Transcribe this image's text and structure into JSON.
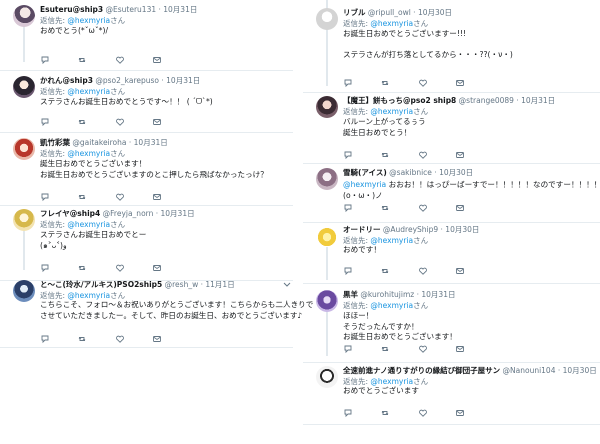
{
  "reply_prefix": "返信先: ",
  "reply_suffix": "さん",
  "colors": {
    "accent": "#1b95e0",
    "muted": "#657786",
    "thread": "#e1e8ed"
  },
  "left": [
    {
      "name": "Esuteru@ship3",
      "handle": "@Esuteru131",
      "date": "10月31日",
      "reply_to": "@hexmyria",
      "lines": [
        "おめでとう(*ˇωˇ*)/"
      ],
      "avatar": "avatar-esuteru"
    },
    {
      "name": "かれん@ship3",
      "handle": "@pso2_karepuso",
      "date": "10月31日",
      "reply_to": "@hexmyria",
      "lines": [
        "ステラさんお誕生日おめでとうです～！！ ( ´ᗜ`*)"
      ],
      "avatar": "avatar-karen"
    },
    {
      "name": "凱竹彩葉",
      "handle": "@gaitakeiroha",
      "date": "10月31日",
      "reply_to": "@hexmyria",
      "lines": [
        "誕生日おめでとうございます！",
        "お誕生日おめでとうございますのとこ押したら飛ばなかったっけ？"
      ],
      "avatar": "avatar-iroha"
    },
    {
      "name": "フレイヤ@ship4",
      "handle": "@Freyja_norn",
      "date": "10月31日",
      "reply_to": "@hexmyria",
      "lines": [
        "ステラさんお誕生日おめでとー",
        "(๑˃ᴗ˂)ﻭ"
      ],
      "avatar": "avatar-freyja"
    },
    {
      "name": "と～こ(玲水/アルキス)PSO2ship5",
      "handle": "@resh_w",
      "date": "11月1日",
      "reply_to": "@hexmyria",
      "lines": [
        "こちらこそ、フォロ～＆お祝いありがとうございます！こちらからも二人きりで",
        "させていただきましたー。そして、昨日のお誕生日、おめでとうございます♪"
      ],
      "avatar": "avatar-toko"
    }
  ],
  "right": [
    {
      "name": "リブル",
      "handle": "@ripull_owl",
      "date": "10月30日",
      "reply_to": "@hexmyria",
      "lines": [
        "お誕生日おめでとうございますー!!!",
        "",
        "ステラさんが打ち落としてるから・・・??(・ν・)"
      ],
      "avatar": "avatar-ripull"
    },
    {
      "name": "【魔王】餅もっち@pso2 ship8",
      "handle": "@strange0089",
      "date": "10月31日",
      "reply_to": "@hexmyria",
      "lines": [
        "バルーン上がってるぅう",
        "誕生日おめでとう！"
      ],
      "avatar": "avatar-mochi"
    },
    {
      "name": "雪騎(アイス)",
      "handle": "@sakibnice",
      "date": "10月30日",
      "reply_to": "",
      "lines": [
        "@hexmyria おおお！！はっぴーばーすでー！！！！！なのですー！！！！！ ((",
        "(o・ω・)ノ"
      ],
      "avatar": "avatar-ice"
    },
    {
      "name": "オードリー",
      "handle": "@AudreyShip9",
      "date": "10月30日",
      "reply_to": "@hexmyria",
      "lines": [
        "おめです！"
      ],
      "avatar": "avatar-audrey"
    },
    {
      "name": "黒羊",
      "handle": "@kurohitujimz",
      "date": "10月31日",
      "reply_to": "@hexmyria",
      "lines": [
        "ほほー！",
        "そうだったんですか！",
        "お誕生日おめでとうございます！"
      ],
      "avatar": "avatar-kurohitsuji"
    },
    {
      "name": "全速前進ナノ通りすがりの縁結び御団子屋サン",
      "handle": "@Nanouni104",
      "date": "10月30日",
      "reply_to": "@hexmyria",
      "lines": [
        "おめでとうございます"
      ],
      "avatar": "avatar-nanouni"
    }
  ]
}
